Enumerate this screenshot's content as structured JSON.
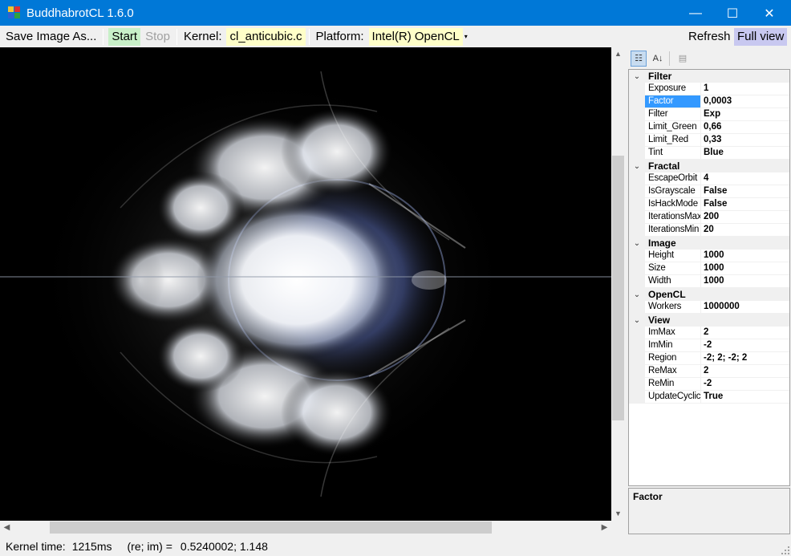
{
  "window": {
    "title": "BuddhabrotCL 1.6.0",
    "minimize_glyph": "—",
    "maximize_glyph": "☐",
    "close_glyph": "✕"
  },
  "toolbar": {
    "save_label": "Save Image As...",
    "start_label": "Start",
    "stop_label": "Stop",
    "kernel_label": "Kernel:",
    "kernel_value": "cl_anticubic.c",
    "platform_label": "Platform:",
    "platform_value": "Intel(R) OpenCL",
    "platform_arrow": "▾",
    "refresh_label": "Refresh",
    "fullview_label": "Full view",
    "colors": {
      "start_bg": "#c8f0c8",
      "yellow_bg": "#ffffc8",
      "fullview_bg": "#c8c8f0"
    }
  },
  "scrollbars": {
    "up": "▲",
    "down": "▼",
    "left": "◀",
    "right": "▶"
  },
  "property_grid": {
    "toolbar": {
      "categorized_icon": "☷",
      "alphabetical_icon": "A↓",
      "properties_icon": "▤"
    },
    "categories": [
      {
        "name": "Filter",
        "chevron": "⌄",
        "rows": [
          {
            "name": "Exposure",
            "value": "1"
          },
          {
            "name": "Factor",
            "value": "0,0003",
            "selected": true
          },
          {
            "name": "Filter",
            "value": "Exp"
          },
          {
            "name": "Limit_Green",
            "value": "0,66"
          },
          {
            "name": "Limit_Red",
            "value": "0,33"
          },
          {
            "name": "Tint",
            "value": "Blue"
          }
        ]
      },
      {
        "name": "Fractal",
        "chevron": "⌄",
        "rows": [
          {
            "name": "EscapeOrbit",
            "value": "4"
          },
          {
            "name": "IsGrayscale",
            "value": "False"
          },
          {
            "name": "IsHackMode",
            "value": "False"
          },
          {
            "name": "IterationsMax",
            "value": "200"
          },
          {
            "name": "IterationsMin",
            "value": "20"
          }
        ]
      },
      {
        "name": "Image",
        "chevron": "⌄",
        "rows": [
          {
            "name": "Height",
            "value": "1000"
          },
          {
            "name": "Size",
            "value": "1000"
          },
          {
            "name": "Width",
            "value": "1000"
          }
        ]
      },
      {
        "name": "OpenCL",
        "chevron": "⌄",
        "rows": [
          {
            "name": "Workers",
            "value": "1000000"
          }
        ]
      },
      {
        "name": "View",
        "chevron": "⌄",
        "rows": [
          {
            "name": "ImMax",
            "value": "2"
          },
          {
            "name": "ImMin",
            "value": "-2"
          },
          {
            "name": "Region",
            "value": "-2; 2; -2; 2"
          },
          {
            "name": "ReMax",
            "value": "2"
          },
          {
            "name": "ReMin",
            "value": "-2"
          },
          {
            "name": "UpdateCyclic",
            "value": "True"
          }
        ]
      }
    ],
    "selection_color": "#3399ff",
    "description_title": "Factor"
  },
  "statusbar": {
    "kernel_time_label": "Kernel time:",
    "kernel_time_value": "1215ms",
    "coord_label": "(re; im) =",
    "coord_value": "0.5240002; 1.148"
  }
}
